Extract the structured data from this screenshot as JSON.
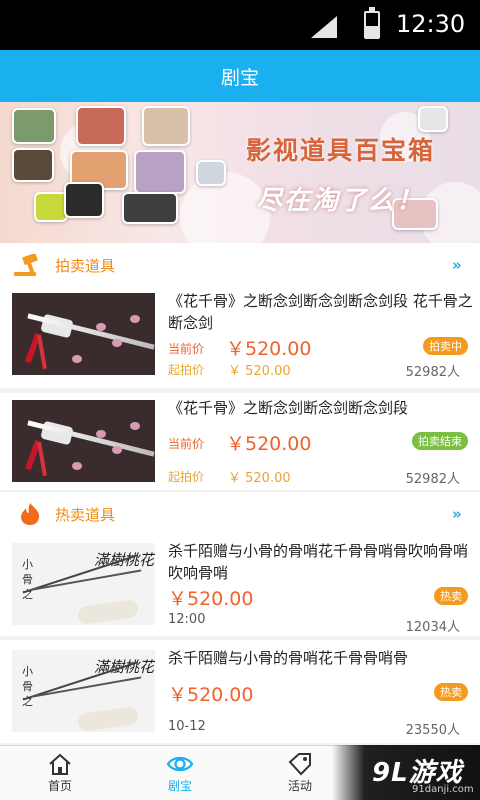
{
  "status_bar": {
    "time": "12:30",
    "icons": [
      "signal-icon",
      "battery-icon"
    ]
  },
  "header": {
    "title": "剧宝"
  },
  "banner": {
    "line1": "影视道具百宝箱",
    "line2": "尽在淘了么！"
  },
  "auction": {
    "section_title": "拍卖道具",
    "items": [
      {
        "title": "《花千骨》之断念剑断念剑断念剑段 花千骨之断念剑",
        "current_label": "当前价",
        "current_price": "￥520.00",
        "start_label": "起拍价",
        "start_price": "￥ 520.00",
        "count": "52982人",
        "status": "拍卖中"
      },
      {
        "title": "《花千骨》之断念剑断念剑断念剑段",
        "current_label": "当前价",
        "current_price": "￥520.00",
        "start_label": "起拍价",
        "start_price": "￥ 520.00",
        "count": "52982人",
        "status": "拍卖结束"
      }
    ]
  },
  "hot": {
    "section_title": "热卖道具",
    "items": [
      {
        "title": "杀千陌赠与小骨的骨哨花千骨骨哨骨吹响骨哨吹响骨哨",
        "price": "￥520.00",
        "badge": "热卖",
        "time": "12:00",
        "count": "12034人"
      },
      {
        "title": "杀千陌赠与小骨的骨哨花千骨骨哨骨",
        "price": "￥520.00",
        "badge": "热卖",
        "time": "10-12",
        "count": "23550人"
      }
    ]
  },
  "bottom_nav": {
    "items": [
      {
        "label": "首页",
        "icon": "home-icon"
      },
      {
        "label": "剧宝",
        "icon": "eye-icon",
        "active": true
      },
      {
        "label": "活动",
        "icon": "tag-icon"
      }
    ]
  },
  "watermark": {
    "logo": "9L游戏",
    "url": "91danji.com"
  },
  "colors": {
    "accent": "#1ab0f0",
    "price": "#f0632a",
    "section": "#f08b14",
    "badge_orange": "#f39b1e",
    "badge_green": "#7bc043"
  }
}
